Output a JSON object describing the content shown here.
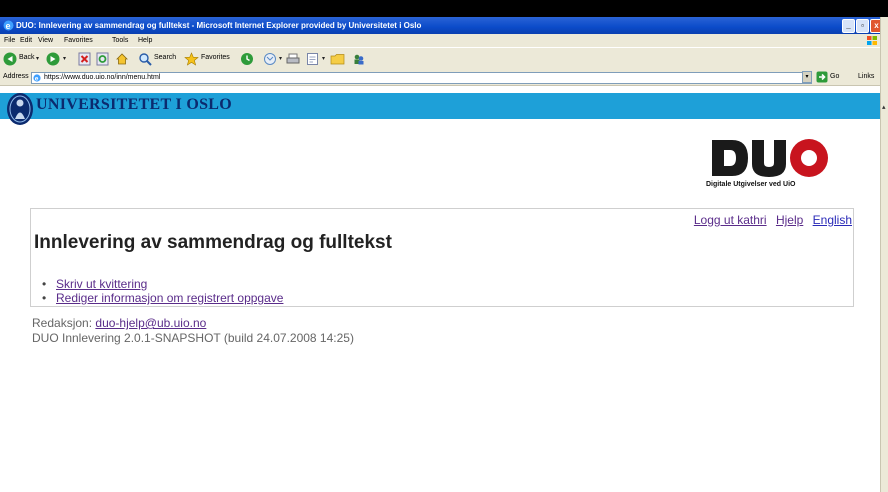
{
  "window": {
    "title": "DUO: Innlevering av sammendrag og fulltekst - Microsoft Internet Explorer provided by Universitetet i Oslo",
    "min_label": "_",
    "max_label": "▫",
    "close_label": "x"
  },
  "menubar": {
    "items": [
      "File",
      "Edit",
      "View",
      "Favorites",
      "Tools",
      "Help"
    ]
  },
  "toolbar": {
    "back_label": "Back",
    "search_label": "Search",
    "favorites_label": "Favorites"
  },
  "addressbar": {
    "label": "Address",
    "url": "https://www.duo.uio.no/inn/menu.html",
    "go_label": "Go",
    "links_label": "Links"
  },
  "page": {
    "university": "UNIVERSITETET I OSLO",
    "duo_logo_text": "DUO",
    "duo_subtitle": "Digitale Utgivelser ved UiO",
    "top_links": {
      "logout": "Logg ut kathri",
      "help": "Hjelp",
      "english": "English"
    },
    "heading": "Innlevering av sammendrag og fulltekst",
    "menu_links": [
      "Skriv ut kvittering",
      "Rediger informasjon om registrert oppgave"
    ],
    "footer": {
      "editor_label": "Redaksjon:",
      "editor_email": "duo-hjelp@ub.uio.no",
      "build": "DUO Innlevering 2.0.1-SNAPSHOT (build 24.07.2008 14:25)"
    }
  },
  "colors": {
    "banner": "#1ea0d8",
    "titlebar": "#0b4bc9",
    "duo_red": "#c8141e",
    "visited_link": "#5a2c8a",
    "link": "#2a2ab8"
  }
}
